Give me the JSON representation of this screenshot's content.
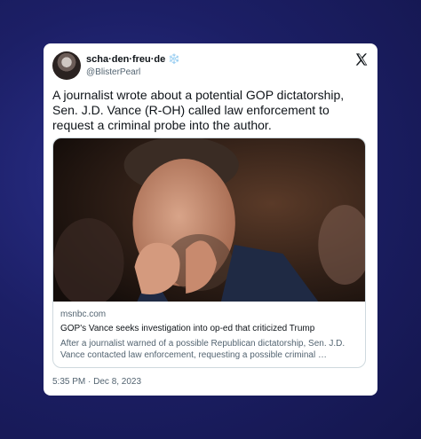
{
  "author": {
    "display_name": "scha·den·freu·de",
    "emoji": "❄️",
    "handle": "@BlisterPearl"
  },
  "platform_icon": "x-logo-icon",
  "tweet": {
    "text": "A journalist wrote about a potential GOP dictatorship, Sen. J.D. Vance (R-OH) called law enforcement to request a criminal probe into the author.",
    "timestamp": "5:35 PM · Dec 8, 2023"
  },
  "link_preview": {
    "domain": "msnbc.com",
    "headline": "GOP's Vance seeks investigation into op-ed that criticized Trump",
    "description": "After a journalist warned of a possible Republican dictatorship, Sen. J.D. Vance contacted law enforcement, requesting a possible criminal …"
  },
  "colors": {
    "background": "#1c1f66",
    "card": "#ffffff",
    "text_primary": "#0f1419",
    "text_secondary": "#536471",
    "border": "#cfd9de"
  }
}
